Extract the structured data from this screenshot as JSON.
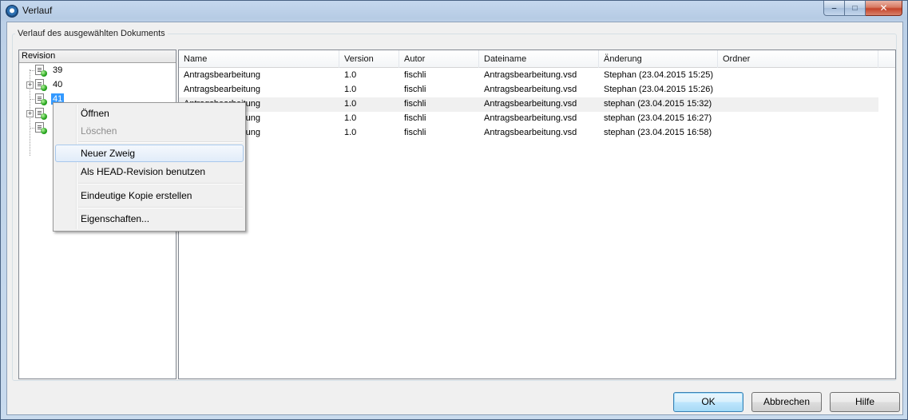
{
  "window": {
    "title": "Verlauf",
    "caption_buttons": {
      "minimize": "‒",
      "maximize": "□",
      "close": "✕"
    }
  },
  "group": {
    "label": "Verlauf des ausgewählten Dokuments"
  },
  "tree": {
    "header": "Revision",
    "items": [
      {
        "label": "39",
        "expandable": false,
        "selected": false
      },
      {
        "label": "40",
        "expandable": true,
        "selected": false
      },
      {
        "label": "41",
        "expandable": false,
        "selected": true
      },
      {
        "label": "",
        "expandable": true,
        "selected": false
      },
      {
        "label": "",
        "expandable": false,
        "selected": false
      }
    ],
    "expander_symbol": "+"
  },
  "list": {
    "columns": [
      "Name",
      "Version",
      "Autor",
      "Dateiname",
      "Änderung",
      "Ordner"
    ],
    "rows": [
      {
        "name": "Antragsbearbeitung",
        "version": "1.0",
        "autor": "fischli",
        "dateiname": "Antragsbearbeitung.vsd",
        "aenderung": "Stephan (23.04.2015 15:25)",
        "ordner": ""
      },
      {
        "name": "Antragsbearbeitung",
        "version": "1.0",
        "autor": "fischli",
        "dateiname": "Antragsbearbeitung.vsd",
        "aenderung": "Stephan (23.04.2015 15:26)",
        "ordner": ""
      },
      {
        "name": "Antragsbearbeitung",
        "version": "1.0",
        "autor": "fischli",
        "dateiname": "Antragsbearbeitung.vsd",
        "aenderung": "stephan (23.04.2015 15:32)",
        "ordner": ""
      },
      {
        "name": "Antragsbearbeitung",
        "version": "1.0",
        "autor": "fischli",
        "dateiname": "Antragsbearbeitung.vsd",
        "aenderung": "stephan (23.04.2015 16:27)",
        "ordner": ""
      },
      {
        "name": "Antragsbearbeitung",
        "version": "1.0",
        "autor": "fischli",
        "dateiname": "Antragsbearbeitung.vsd",
        "aenderung": "stephan (23.04.2015 16:58)",
        "ordner": ""
      }
    ]
  },
  "context_menu": {
    "items": [
      {
        "label": "Öffnen",
        "disabled": false
      },
      {
        "label": "Löschen",
        "disabled": true
      },
      {
        "label": "Neuer Zweig",
        "disabled": false,
        "hover": true
      },
      {
        "label": "Als HEAD-Revision benutzen",
        "disabled": false
      },
      {
        "label": "Eindeutige Kopie erstellen",
        "disabled": false
      },
      {
        "label": "Eigenschaften...",
        "disabled": false
      }
    ]
  },
  "buttons": {
    "ok": "OK",
    "cancel": "Abbrechen",
    "help": "Hilfe"
  }
}
